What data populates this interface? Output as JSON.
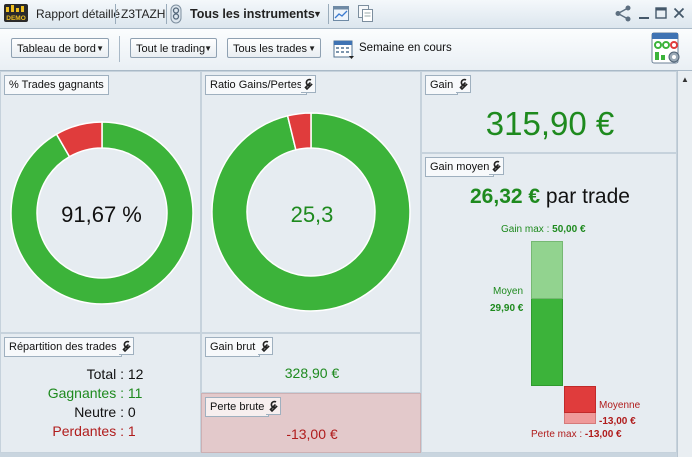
{
  "titlebar": {
    "demo_logo": "DEMO",
    "report_title": "Rapport détaillé",
    "account": "Z3TAZH",
    "instruments_selector": "Tous les instruments",
    "icons": [
      "demo-logo-icon",
      "link-icon",
      "chart-window-icon",
      "duplicate-icon",
      "share-icon",
      "minimize-icon",
      "maximize-icon",
      "close-icon"
    ]
  },
  "toolbar": {
    "dashboard_dropdown": "Tableau de bord",
    "trading_dropdown": "Tout le trading",
    "trades_dropdown": "Tous les trades",
    "period_label": "Semaine en cours",
    "icons": [
      "calendar-icon",
      "report-settings-icon"
    ]
  },
  "win_rate": {
    "title": "% Trades gagnants",
    "value_text": "91,67 %",
    "win_fraction": 0.9167,
    "colors": {
      "win": "#3cb33a",
      "loss": "#e03c3c"
    }
  },
  "gain_loss_ratio": {
    "title": "Ratio Gains/Pertes",
    "value_text": "25,3",
    "gain_fraction": 0.962,
    "colors": {
      "gain": "#3cb33a",
      "loss": "#e03c3c"
    }
  },
  "gain": {
    "title": "Gain",
    "value": "315,90 €",
    "color": "#1e8a1e"
  },
  "avg_gain": {
    "title": "Gain moyen",
    "headline_value": "26,32 €",
    "headline_suffix": "par trade",
    "max_gain_label": "Gain max :",
    "max_gain_value": "50,00 €",
    "avg_win_label": "Moyen",
    "avg_win_value": "29,90 €",
    "avg_loss_label": "Moyenne",
    "avg_loss_value": "-13,00 €",
    "max_loss_label": "Perte max :",
    "max_loss_value": "-13,00 €"
  },
  "distribution": {
    "title": "Répartition des trades",
    "rows": [
      {
        "label": "Total :",
        "value": "12",
        "color": "#111111"
      },
      {
        "label": "Gagnantes :",
        "value": "11",
        "color": "#1e8a1e"
      },
      {
        "label": "Neutre :",
        "value": "0",
        "color": "#111111"
      },
      {
        "label": "Perdantes :",
        "value": "1",
        "color": "#b01c1c"
      }
    ]
  },
  "gross_gain": {
    "title": "Gain brut",
    "value": "328,90 €",
    "color": "#1e8a1e"
  },
  "gross_loss": {
    "title": "Perte brute",
    "value": "-13,00 €",
    "color": "#b01c1c"
  }
}
